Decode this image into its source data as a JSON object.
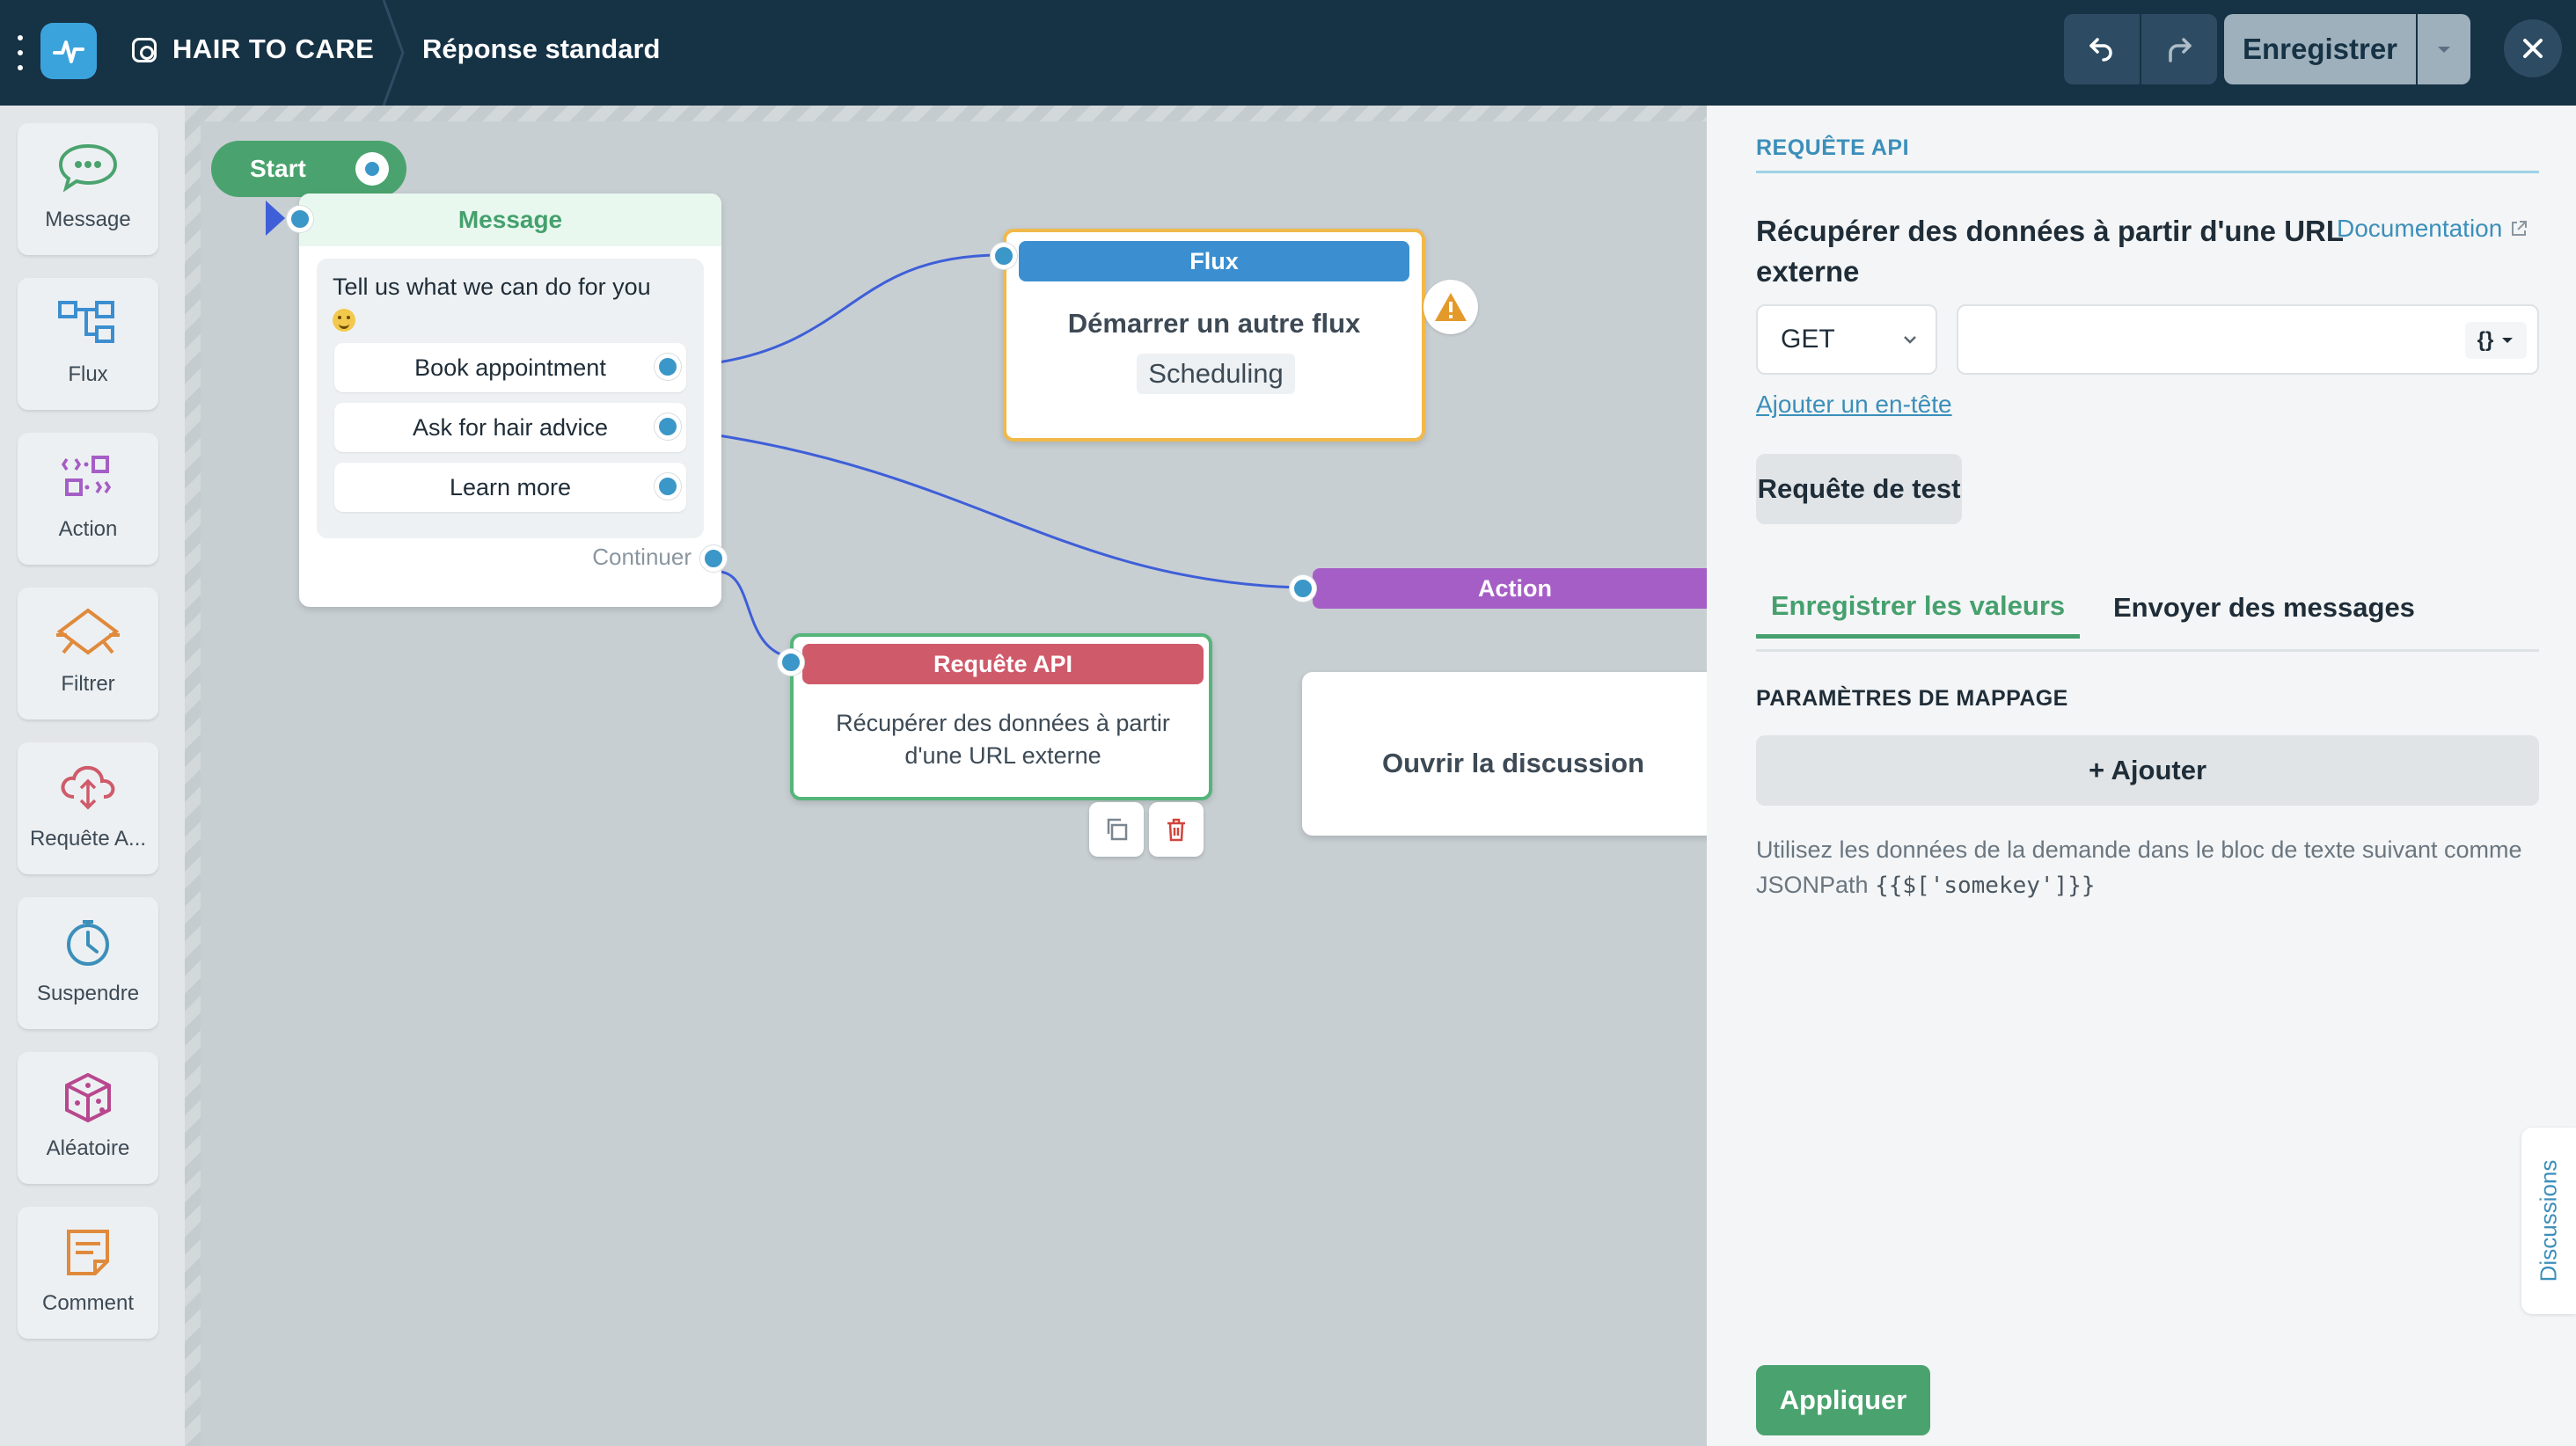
{
  "topbar": {
    "bot_name": "HAIR TO CARE",
    "flow_name": "Réponse standard",
    "save_label": "Enregistrer"
  },
  "toolbox": {
    "items": [
      {
        "label": "Message",
        "icon": "chat-bubble-icon",
        "color": "#4aa36e"
      },
      {
        "label": "Flux",
        "icon": "flow-icon",
        "color": "#3b8fd0"
      },
      {
        "label": "Action",
        "icon": "action-icon",
        "color": "#a55ec5"
      },
      {
        "label": "Filtrer",
        "icon": "filter-icon",
        "color": "#e08a3c"
      },
      {
        "label": "Requête A...",
        "icon": "cloud-api-icon",
        "color": "#cf5a6a"
      },
      {
        "label": "Suspendre",
        "icon": "clock-icon",
        "color": "#3b8fba"
      },
      {
        "label": "Aléatoire",
        "icon": "dice-icon",
        "color": "#b8478f"
      },
      {
        "label": "Comment",
        "icon": "note-icon",
        "color": "#e08a3c"
      }
    ]
  },
  "canvas": {
    "start_label": "Start",
    "message_node": {
      "title": "Message",
      "text": "Tell us what we can do for you",
      "quick_replies": [
        "Book appointment",
        "Ask for hair advice",
        "Learn more"
      ],
      "continue_label": "Continuer"
    },
    "flux_node": {
      "title": "Flux",
      "description": "Démarrer un autre flux",
      "chip": "Scheduling"
    },
    "api_node": {
      "title": "Requête API",
      "description": "Récupérer des données à partir d'une URL externe"
    },
    "action_node": {
      "title": "Action",
      "description": "Ouvrir la discussion"
    }
  },
  "panel": {
    "kicker": "REQUÊTE API",
    "title": "Récupérer des données à partir d'une URL externe",
    "doc_link": "Documentation",
    "method": "GET",
    "url_value": "",
    "var_button": "{}",
    "add_header": "Ajouter un en-tête",
    "test_button": "Requête de test",
    "tabs": [
      "Enregistrer les valeurs",
      "Envoyer des messages"
    ],
    "mapping_title": "PARAMÈTRES DE MAPPAGE",
    "add_button": "+ Ajouter",
    "help_text": "Utilisez les données de la demande dans le bloc de texte suivant comme JSONPath",
    "help_code": "{{$['somekey']}}",
    "discussions_tab": "Discussions",
    "apply_button": "Appliquer"
  },
  "colors": {
    "topbar": "#163245",
    "accent_green": "#4aa36e",
    "link_blue": "#3b8fba"
  }
}
